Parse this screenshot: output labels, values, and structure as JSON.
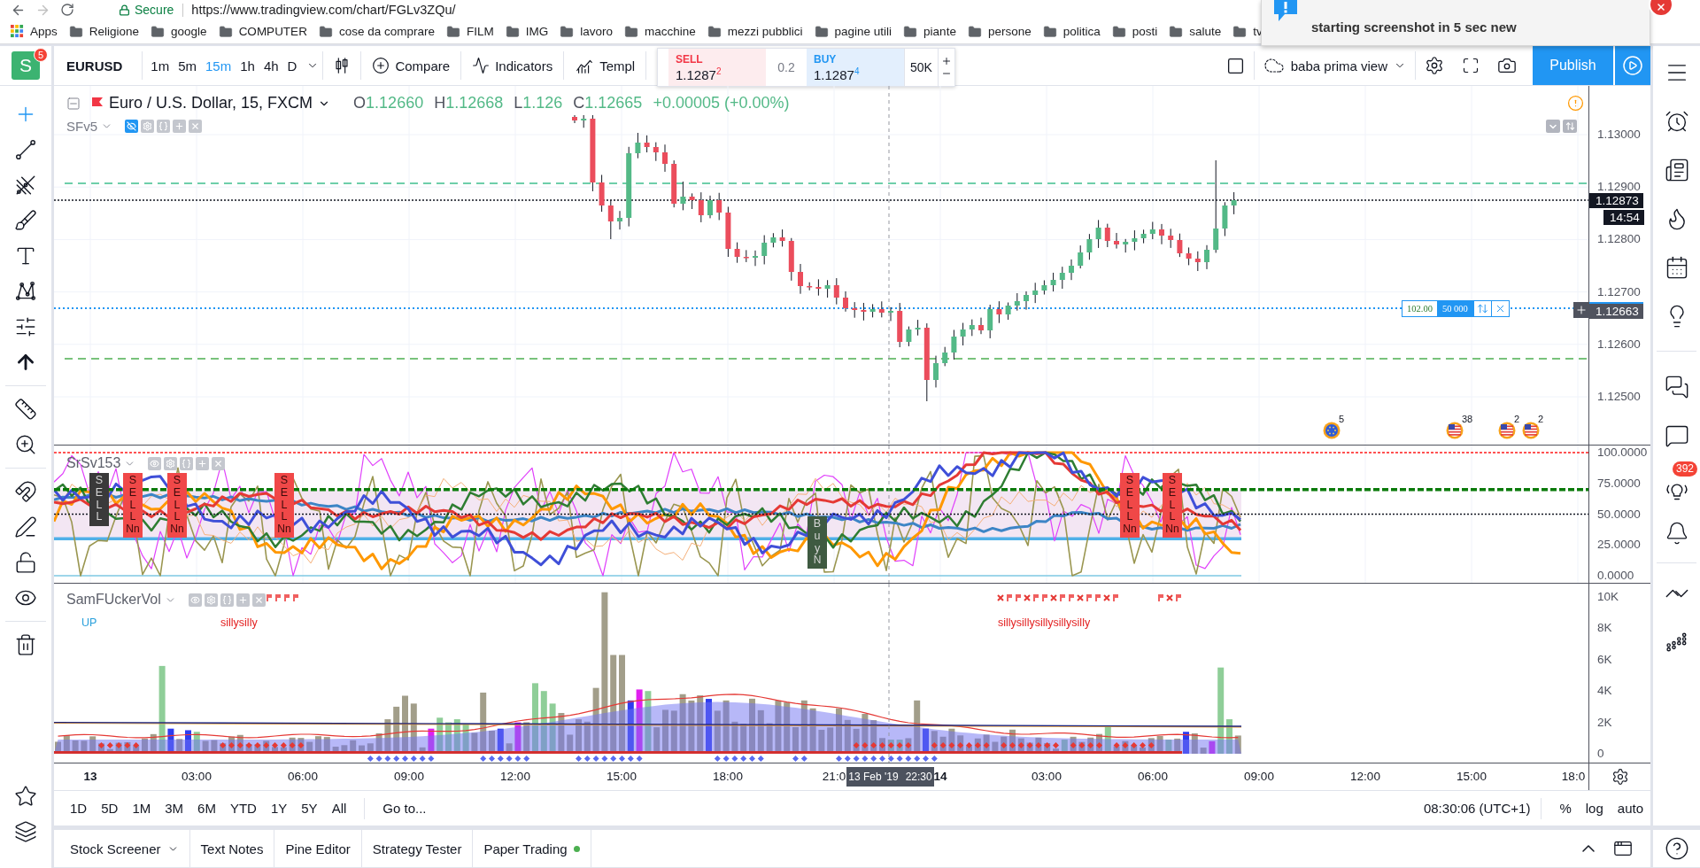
{
  "browser": {
    "secure": "Secure",
    "url": "https://www.tradingview.com/chart/FGLv3ZQu/",
    "bookmarks": [
      {
        "kind": "apps",
        "label": "Apps"
      },
      {
        "kind": "folder",
        "label": "Religione"
      },
      {
        "kind": "folder",
        "label": "google"
      },
      {
        "kind": "folder",
        "label": "COMPUTER"
      },
      {
        "kind": "folder",
        "label": "cose da comprare"
      },
      {
        "kind": "folder",
        "label": "FILM"
      },
      {
        "kind": "folder",
        "label": "IMG"
      },
      {
        "kind": "folder",
        "label": "lavoro"
      },
      {
        "kind": "folder",
        "label": "macchine"
      },
      {
        "kind": "folder",
        "label": "mezzi pubblici"
      },
      {
        "kind": "folder",
        "label": "pagine utili"
      },
      {
        "kind": "folder",
        "label": "piante"
      },
      {
        "kind": "folder",
        "label": "persone"
      },
      {
        "kind": "folder",
        "label": "politica"
      },
      {
        "kind": "folder",
        "label": "posti"
      },
      {
        "kind": "folder",
        "label": "salute"
      },
      {
        "kind": "folder",
        "label": "tv"
      }
    ]
  },
  "notification": {
    "text": "starting screenshot in 5 sec new"
  },
  "header": {
    "avatar": {
      "letter": "S",
      "badge": "5"
    },
    "symbol": "EURUSD",
    "intervals": [
      {
        "label": "1m",
        "selected": false
      },
      {
        "label": "5m",
        "selected": false
      },
      {
        "label": "15m",
        "selected": true
      },
      {
        "label": "1h",
        "selected": false
      },
      {
        "label": "4h",
        "selected": false
      },
      {
        "label": "D",
        "selected": false
      }
    ],
    "tools": [
      {
        "kind": "compare",
        "label": "Compare"
      },
      {
        "kind": "indicators",
        "label": "Indicators"
      },
      {
        "kind": "templates",
        "label": "Templ"
      }
    ],
    "trade": {
      "sell": {
        "label": "SELL",
        "price": "1.1287$^{2}$"
      },
      "spread": "0.2",
      "buy": {
        "label": "BUY",
        "price": "1.1287$^{4}$"
      },
      "quantity": "50K"
    },
    "layout": "baba prima view",
    "publish": "Publish"
  },
  "left_toolbar": {
    "groups": [
      [
        {
          "kind": "crosshair",
          "selected": true
        },
        {
          "kind": "trend_line",
          "selected": false
        },
        {
          "kind": "pitchfork",
          "selected": false
        },
        {
          "kind": "brush",
          "selected": false
        },
        {
          "kind": "text",
          "selected": false
        },
        {
          "kind": "pattern",
          "selected": false
        },
        {
          "kind": "prediction",
          "selected": false
        },
        {
          "kind": "arrow",
          "selected": false
        }
      ],
      [
        {
          "kind": "ruler",
          "selected": false
        },
        {
          "kind": "zoom",
          "selected": false
        }
      ],
      [
        {
          "kind": "magnet",
          "selected": false
        },
        {
          "kind": "lock_drawings",
          "selected": false
        },
        {
          "kind": "lock",
          "selected": false
        },
        {
          "kind": "eye",
          "selected": false
        }
      ],
      [
        {
          "kind": "trash",
          "selected": false
        }
      ]
    ],
    "bottom": [
      {
        "kind": "star",
        "selected": false
      },
      {
        "kind": "layers",
        "selected": false
      }
    ]
  },
  "main_chart": {
    "legend": {
      "title": "Euro / U.S. Dollar, 15, FXCM",
      "ohlc": [
        {
          "label": "O",
          "value": "1.12660"
        },
        {
          "label": "H",
          "value": "1.12668"
        },
        {
          "label": "L",
          "value": "1.126"
        },
        {
          "label": "C",
          "value": "1.12665"
        }
      ],
      "change": "+0.00005 (+0.00%)"
    },
    "indicator": "SFv5",
    "price_axis": {
      "ticks": [
        "1.13000",
        "1.12900",
        "1.12800",
        "1.12700",
        "1.12600",
        "1.12500"
      ],
      "last_price": "1.12873",
      "countdown": "14:54",
      "order_price": "1.12663"
    },
    "order": {
      "price": "102.00",
      "quantity": "50 000"
    },
    "events": [
      {
        "kind": "eu",
        "count": "5"
      },
      {
        "kind": "us",
        "count": "38"
      },
      {
        "kind": "us",
        "count": "2"
      },
      {
        "kind": "us",
        "count": "2"
      }
    ]
  },
  "oscillator": {
    "name": "SrSv153",
    "ticks": [
      "100.0000",
      "75.0000",
      "50.0000",
      "25.0000",
      "0.0000"
    ],
    "signals": [
      {
        "word": "SELL",
        "color": "#3a3a3a"
      },
      {
        "word": "SELL",
        "suffix": "Nn",
        "color": "#f04848"
      },
      {
        "word": "SELL",
        "suffix": "Nn",
        "color": "#f04848"
      },
      {
        "word": "SELL",
        "suffix": "Nn",
        "color": "#f04848"
      },
      {
        "word": "Buy",
        "suffix": "N",
        "color": "#3f5a41"
      },
      {
        "word": "SELL",
        "suffix": "Nn",
        "color": "#f04848"
      },
      {
        "word": "SELL",
        "suffix": "Nn",
        "color": "#f04848"
      }
    ]
  },
  "volume": {
    "name": "SamFUckerVol",
    "ticks": [
      "10K",
      "8K",
      "6K",
      "4K",
      "2K",
      "0"
    ],
    "labels": [
      {
        "text": "UP",
        "color": "#2aa0dc"
      },
      {
        "text": "sillysilly",
        "color": "#e32020"
      },
      {
        "text": "sillysillysillysillysilly",
        "color": "#e32020"
      }
    ]
  },
  "time_axis": {
    "ticks": [
      {
        "label": "13",
        "kind": "day"
      },
      {
        "label": "03:00",
        "kind": "time"
      },
      {
        "label": "06:00",
        "kind": "time"
      },
      {
        "label": "09:00",
        "kind": "time"
      },
      {
        "label": "12:00",
        "kind": "time"
      },
      {
        "label": "15:00",
        "kind": "time"
      },
      {
        "label": "18:00",
        "kind": "time"
      },
      {
        "label": "21:0",
        "kind": "time"
      },
      {
        "label": "14",
        "kind": "day"
      },
      {
        "label": "03:00",
        "kind": "time"
      },
      {
        "label": "06:00",
        "kind": "time"
      },
      {
        "label": "09:00",
        "kind": "time"
      },
      {
        "label": "12:00",
        "kind": "time"
      },
      {
        "label": "15:00",
        "kind": "time"
      },
      {
        "label": "18:0",
        "kind": "time"
      }
    ],
    "crosshair": {
      "date": "13 Feb '19",
      "time": "22:30"
    }
  },
  "range_bar": {
    "ranges": [
      "1D",
      "5D",
      "1M",
      "3M",
      "6M",
      "YTD",
      "1Y",
      "5Y",
      "All"
    ],
    "goto": "Go to...",
    "clock": "08:30:06 (UTC+1)",
    "scales": [
      "%",
      "log",
      "auto"
    ]
  },
  "bottom_tabs": [
    {
      "label": "Stock Screener",
      "kind": "menu"
    },
    {
      "label": "Text Notes",
      "kind": "plain"
    },
    {
      "label": "Pine Editor",
      "kind": "plain"
    },
    {
      "label": "Strategy Tester",
      "kind": "plain"
    },
    {
      "label": "Paper Trading",
      "kind": "status",
      "color": "#4caf50"
    }
  ],
  "right_sidebar": {
    "groups": [
      [
        {
          "kind": "menu"
        },
        {
          "kind": "alarms"
        },
        {
          "kind": "news"
        },
        {
          "kind": "hotlist"
        },
        {
          "kind": "calendar"
        },
        {
          "kind": "ideas"
        }
      ],
      [
        {
          "kind": "chats"
        },
        {
          "kind": "chat"
        },
        {
          "kind": "streams",
          "badge": "392"
        },
        {
          "kind": "alerts"
        }
      ],
      [
        {
          "kind": "dom"
        },
        {
          "kind": "order_panel"
        }
      ]
    ]
  }
}
